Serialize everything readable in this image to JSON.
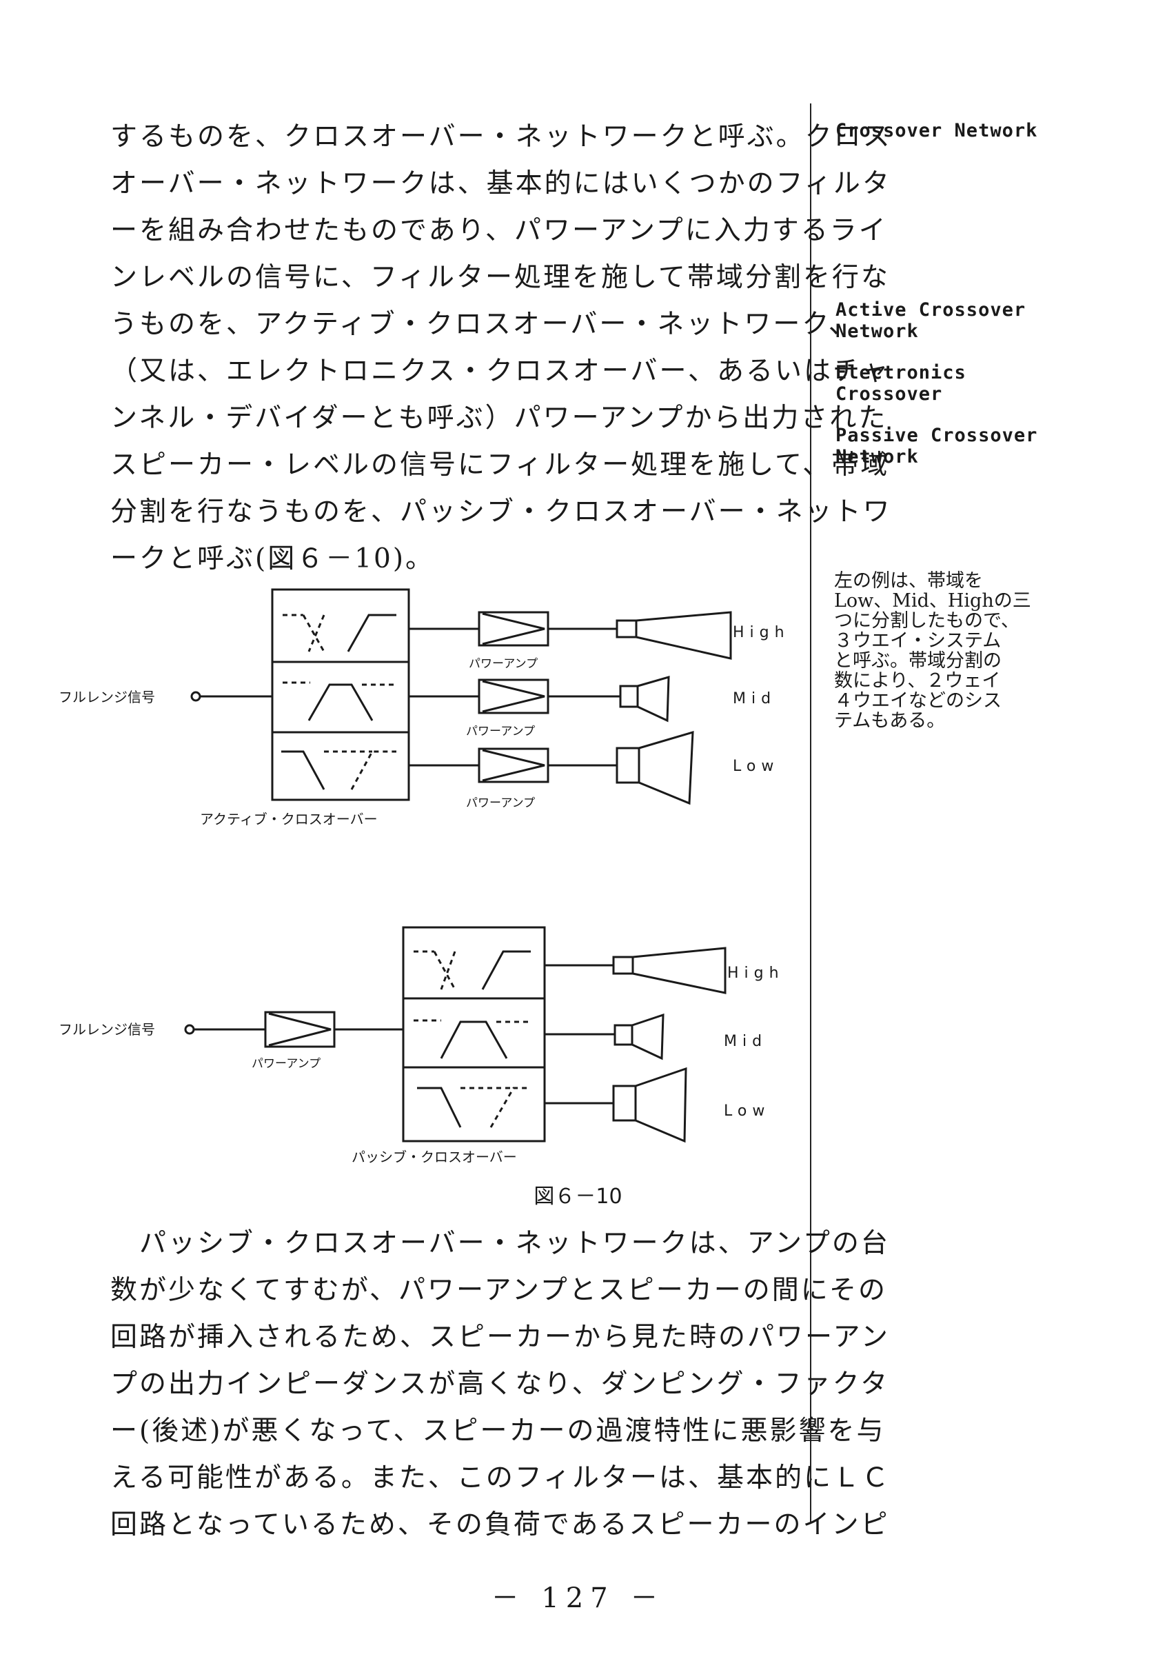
{
  "paragraph1": [
    "するものを、クロスオーバー・ネットワークと呼ぶ。クロス",
    "オーバー・ネットワークは、基本的にはいくつかのフィルタ",
    "ーを組み合わせたものであり、パワーアンプに入力するライ",
    "ンレベルの信号に、フィルター処理を施して帯域分割を行な",
    "うものを、アクティブ・クロスオーバー・ネットワーク、",
    "（又は、エレクトロニクス・クロスオーバー、あるいはチャ",
    "ンネル・デバイダーとも呼ぶ）パワーアンプから出力された",
    "スピーカー・レベルの信号にフィルター処理を施して、帯域",
    "分割を行なうものを、パッシブ・クロスオーバー・ネットワ",
    "ークと呼ぶ(図６－10)。"
  ],
  "sidebar": {
    "term1": "Crossover Network",
    "term2": "Active Crossover\nNetwork",
    "term3": "Electronics\nCrossover",
    "term4": "Passive Crossover\nNetwork",
    "note": "左の例は、帯域を\nLow、Mid、Highの三\nつに分割したもので、\n３ウエイ・システム\nと呼ぶ。帯域分割の\n数により、２ウェイ\n４ウエイなどのシス\nテムもある。"
  },
  "figure": {
    "input_label": "フルレンジ信号",
    "amp_label": "パワーアンプ",
    "active_label": "アクティブ・クロスオーバー",
    "passive_label": "パッシブ・クロスオーバー",
    "band_high": "High",
    "band_mid": "Mid",
    "band_low": "Low",
    "caption": "図６－10"
  },
  "paragraph2": [
    "　パッシブ・クロスオーバー・ネットワークは、アンプの台",
    "数が少なくてすむが、パワーアンプとスピーカーの間にその",
    "回路が挿入されるため、スピーカーから見た時のパワーアン",
    "プの出力インピーダンスが高くなり、ダンピング・ファクタ",
    "ー(後述)が悪くなって、スピーカーの過渡特性に悪影響を与",
    "える可能性がある。また、このフィルターは、基本的にＬＣ",
    "回路となっているため、その負荷であるスピーカーのインピ"
  ],
  "page_number": "－ 127 －"
}
